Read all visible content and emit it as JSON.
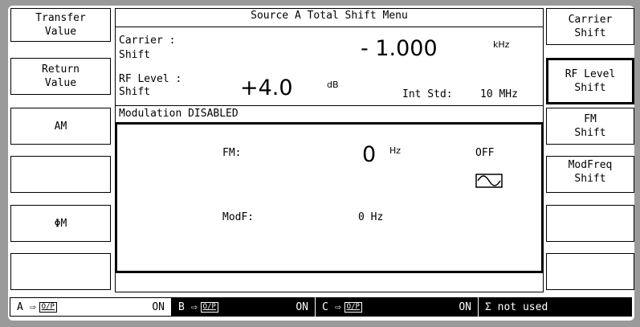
{
  "header": {
    "title": "Source A Total Shift Menu"
  },
  "left_softkeys": [
    {
      "line1": "Transfer",
      "line2": "Value"
    },
    {
      "line1": "Return",
      "line2": "Value"
    },
    {
      "line1": "AM",
      "line2": ""
    },
    {
      "line1": "",
      "line2": ""
    },
    {
      "line1": "ΦM",
      "line2": ""
    },
    {
      "line1": "",
      "line2": ""
    }
  ],
  "right_softkeys": [
    {
      "line1": "Carrier",
      "line2": "Shift"
    },
    {
      "line1": "RF Level",
      "line2": "Shift"
    },
    {
      "line1": "FM",
      "line2": "Shift"
    },
    {
      "line1": "ModFreq",
      "line2": "Shift"
    },
    {
      "line1": "",
      "line2": ""
    },
    {
      "line1": "",
      "line2": ""
    }
  ],
  "carrier": {
    "label1": "Carrier :",
    "label2": "Shift",
    "value": "- 1.000",
    "unit": "kHz"
  },
  "rf_level": {
    "label1": "RF Level :",
    "label2": "Shift",
    "value": "+4.0",
    "unit": "dB"
  },
  "int_std": {
    "label": "Int Std:",
    "value": "10 MHz"
  },
  "modulation_status": "Modulation DISABLED",
  "fm": {
    "label": "FM:",
    "value": "0",
    "unit": "Hz",
    "state": "OFF"
  },
  "modf": {
    "label": "ModF:",
    "value": "0 Hz"
  },
  "status_bar": [
    {
      "source": "A",
      "arrow": "⇨",
      "op": "O/P",
      "state": "ON",
      "style": "light"
    },
    {
      "source": "B",
      "arrow": "⇨",
      "op": "O/P",
      "state": "ON",
      "style": "dark"
    },
    {
      "source": "C",
      "arrow": "⇨",
      "op": "O/P",
      "state": "ON",
      "style": "dark"
    },
    {
      "sigma": "Σ not used",
      "style": "dark"
    }
  ],
  "icons": {
    "waveform": "sine-wave-icon"
  }
}
